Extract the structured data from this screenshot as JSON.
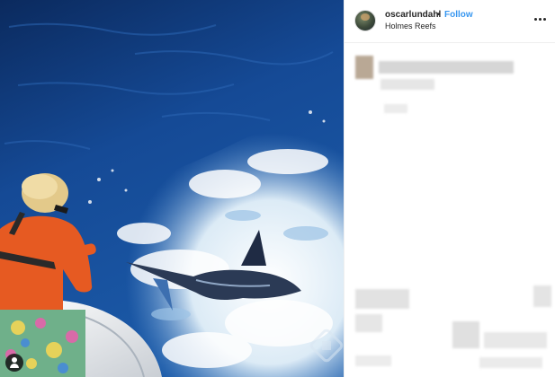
{
  "post": {
    "username": "oscarlundahl",
    "separator": "•",
    "follow_label": "Follow",
    "location": "Holmes Reefs",
    "more_icon": "more-options-icon",
    "tag_icon": "user-tag-icon"
  },
  "colors": {
    "follow": "#3897f0",
    "ocean_deep": "#0c2f66",
    "ocean_mid": "#1a4f9a",
    "foam": "#eef5fb",
    "shirt": "#e65a22"
  }
}
